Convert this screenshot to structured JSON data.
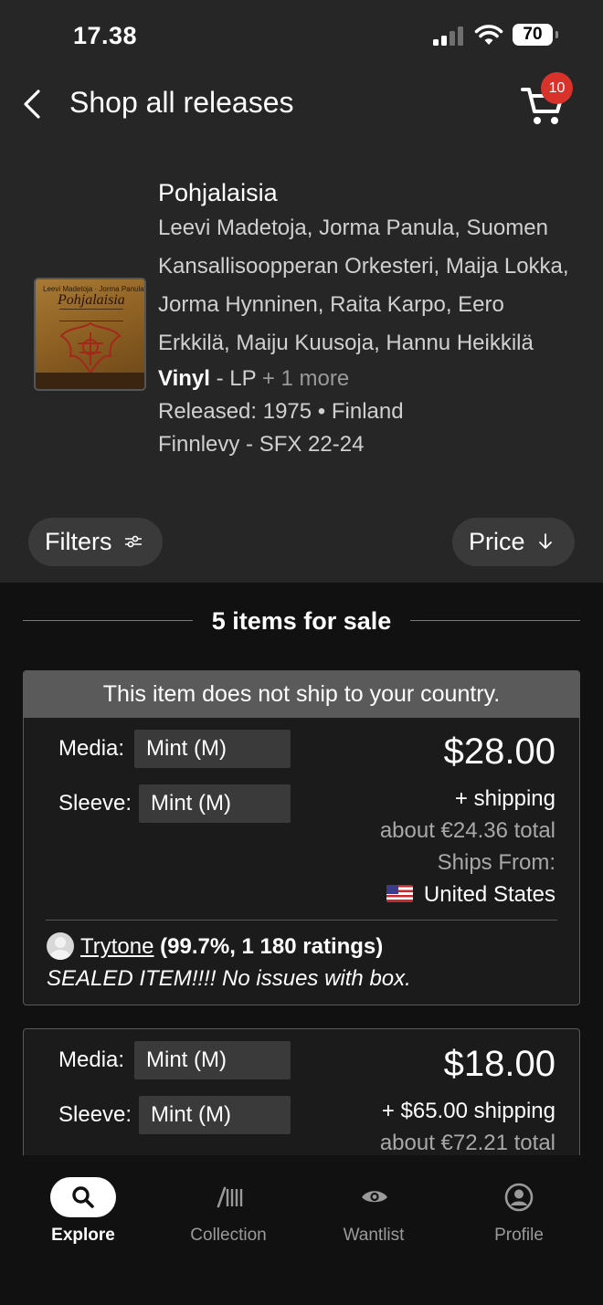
{
  "status_bar": {
    "time": "17.38",
    "battery": "70"
  },
  "nav": {
    "title": "Shop all releases",
    "cart_count": "10"
  },
  "release": {
    "title": "Pohjalaisia",
    "artists": "Leevi Madetoja, Jorma Panula, Suomen Kansallisoopperan Orkesteri, Maija Lokka, Jorma Hynninen, Raita Karpo, Eero Erkkilä, Maiju Kuusoja, Hannu Heikkilä",
    "format_bold": "Vinyl",
    "format_rest": " - LP",
    "format_more": "+ 1 more",
    "released": "Released: 1975 • Finland",
    "label": "Finnlevy - SFX 22-24",
    "cover_text_top": "Leevi Madetoja · Jorma Panula",
    "cover_text_title": "Pohjalaisia"
  },
  "filters": {
    "filters_label": "Filters",
    "sort_label": "Price"
  },
  "sale_header": "5 items for sale",
  "listings": [
    {
      "banner": "This item does not ship to your country.",
      "media_label": "Media:",
      "media_value": "Mint (M)",
      "sleeve_label": "Sleeve:",
      "sleeve_value": "Mint (M)",
      "price": "$28.00",
      "shipping": "+  shipping",
      "total": "about €24.36 total",
      "ships_from_label": "Ships From:",
      "ships_from_country": "United States",
      "seller_name": "Trytone",
      "seller_rating": "(99.7%, 1 180 ratings)",
      "comment": "SEALED ITEM!!!! No issues with box."
    },
    {
      "media_label": "Media:",
      "media_value": "Mint (M)",
      "sleeve_label": "Sleeve:",
      "sleeve_value": "Mint (M)",
      "price": "$18.00",
      "shipping": "+ $65.00 shipping",
      "total": "about €72.21 total"
    }
  ],
  "tabs": [
    {
      "label": "Explore",
      "icon": "search-icon",
      "active": true
    },
    {
      "label": "Collection",
      "icon": "collection-icon",
      "active": false
    },
    {
      "label": "Wantlist",
      "icon": "eye-icon",
      "active": false
    },
    {
      "label": "Profile",
      "icon": "profile-icon",
      "active": false
    }
  ],
  "colors": {
    "badge": "#d9322b",
    "background": "#111111",
    "panel": "#262626",
    "pill": "#3a3a3a"
  }
}
